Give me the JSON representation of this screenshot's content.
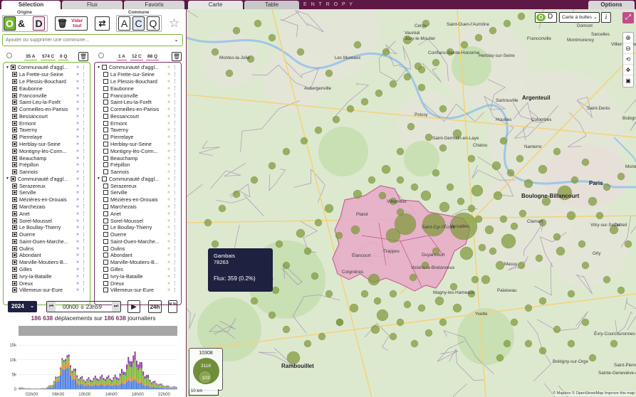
{
  "tabs": {
    "selection": "Sélection",
    "flux": "Flux",
    "favoris": "Favoris"
  },
  "map_tabs": {
    "carte": "Carte",
    "table": "Table",
    "options": "Options"
  },
  "brand": "E N T R O P Y",
  "origine": {
    "title": "Origine",
    "o_label": "O",
    "amp": "&",
    "d_label": "D",
    "vider": "Vider tout",
    "swap": "⇄"
  },
  "commune": {
    "title": "Commune",
    "a": "A",
    "c": "C",
    "q": "Q"
  },
  "search": {
    "placeholder": "Ajouter ou supprimer une commune..."
  },
  "left_list": {
    "counts": {
      "a": "35 A",
      "c": "574 C",
      "q": "0 Q"
    },
    "group1": "Communauté d'aggl...",
    "items1": [
      "La Frette-sur-Seine",
      "Le Plessis-Bouchard",
      "Eaubonne",
      "Franconville",
      "Saint-Leu-la-Forêt",
      "Cormeilles-en-Parisis",
      "Bessancourt",
      "Ermont",
      "Taverny",
      "Pierrelaye",
      "Herblay-sur-Seine",
      "Montigny-lès-Corm...",
      "Beauchamp",
      "Frépillon",
      "Sannois"
    ],
    "group2": "Communauté d'aggl...",
    "items2": [
      "Serazereux",
      "Serville",
      "Mézières-en-Drouais",
      "Marchezais",
      "Anet",
      "Sorel-Moussel",
      "Le Boullay-Thierry",
      "Ouerre",
      "Saint-Ouen-Marche...",
      "Oulins",
      "Abondant",
      "Marville-Moutiers-B...",
      "Gilles",
      "Ivry-la-Bataille",
      "Dreux",
      "Villemeux-sur-Eure"
    ]
  },
  "right_list": {
    "counts": {
      "a": "1 A",
      "c": "12 C",
      "q": "88 Q"
    },
    "group1": "Communauté d'aggl...",
    "items1": [
      "La Frette-sur-Seine",
      "Le Plessis-Bouchard",
      "Eaubonne",
      "Franconville",
      "Saint-Leu-la-Forêt",
      "Cormeilles-en-Parisis",
      "Bessancourt",
      "Ermont",
      "Taverny",
      "Pierrelaye",
      "Herblay-sur-Seine",
      "Montigny-lès-Corm...",
      "Beauchamp",
      "Frépillon",
      "Sannois"
    ],
    "group2": "Communauté d'aggl...",
    "items2": [
      "Serazereux",
      "Serville",
      "Mézières-en-Drouais",
      "Marchezais",
      "Anet",
      "Sorel-Moussel",
      "Le Boullay-Thierry",
      "Ouerre",
      "Saint-Ouen-Marche...",
      "Oulins",
      "Abondant",
      "Marville-Moutiers-B...",
      "Gilles",
      "Ivry-la-Bataille",
      "Dreux",
      "Villemeux-sur-Eure"
    ]
  },
  "time": {
    "year": "2024",
    "from": "00h00",
    "a": "à",
    "to": "23h59",
    "h24": "24h",
    "pct": "N %"
  },
  "summary": {
    "count1": "186 638",
    "mid": "déplacements sur",
    "count2": "186 638",
    "tail": "journaliers"
  },
  "chart_data": {
    "type": "bar",
    "stacked": true,
    "x_ticks": [
      "02h00",
      "06h00",
      "10h00",
      "14h00",
      "18h00",
      "22h00"
    ],
    "y_ticks": [
      "0",
      "5k",
      "10k",
      "15k"
    ],
    "ylim": [
      0,
      16000
    ],
    "categories": [
      "00h",
      "01h",
      "02h",
      "03h",
      "04h",
      "05h",
      "06h",
      "07h",
      "08h",
      "09h",
      "10h",
      "11h",
      "12h",
      "13h",
      "14h",
      "15h",
      "16h",
      "17h",
      "18h",
      "19h",
      "20h",
      "21h",
      "22h",
      "23h"
    ],
    "series": [
      {
        "color": "#4c7ee0",
        "values": [
          300,
          150,
          100,
          100,
          200,
          900,
          3500,
          8500,
          4000,
          1800,
          1200,
          1300,
          1500,
          1400,
          1300,
          1500,
          2200,
          3200,
          2500,
          1400,
          800,
          600,
          400,
          300
        ]
      },
      {
        "color": "#e08a2a",
        "values": [
          100,
          50,
          50,
          50,
          80,
          300,
          800,
          2000,
          1500,
          700,
          500,
          500,
          600,
          600,
          500,
          600,
          900,
          1300,
          1100,
          600,
          300,
          200,
          150,
          100
        ]
      },
      {
        "color": "#7ab833",
        "values": [
          150,
          80,
          60,
          60,
          100,
          400,
          900,
          1600,
          1500,
          1200,
          1100,
          1200,
          1400,
          1500,
          1400,
          1700,
          2800,
          4800,
          4500,
          2300,
          1200,
          800,
          500,
          300
        ]
      },
      {
        "color": "#8b3fa8",
        "values": [
          100,
          50,
          40,
          40,
          60,
          200,
          400,
          700,
          800,
          700,
          600,
          700,
          800,
          800,
          700,
          900,
          1400,
          2500,
          2400,
          1200,
          600,
          400,
          250,
          150
        ]
      }
    ]
  },
  "map": {
    "mode": "Carte à bulles ⌄",
    "info": "i",
    "tooltip": {
      "name": "Gambais",
      "code": "78263",
      "flux": "Flux: 359 (0.2%)"
    },
    "legend": {
      "top": "10308",
      "mid": "3118",
      "bot": "103"
    },
    "scale": "10 km",
    "attribution": "© Mapbox © OpenStreetMap Improve this map",
    "towns": [
      {
        "n": "Montes-la-Jolie",
        "x": 46,
        "y": 65
      },
      {
        "n": "Les Mureaux",
        "x": 208,
        "y": 65
      },
      {
        "n": "Aubergenville",
        "x": 165,
        "y": 108
      },
      {
        "n": "Conflans-Sainte-Honorine",
        "x": 339,
        "y": 58
      },
      {
        "n": "Jouy-le-Moutier",
        "x": 306,
        "y": 38
      },
      {
        "n": "Vauréal",
        "x": 306,
        "y": 30
      },
      {
        "n": "Cergy",
        "x": 320,
        "y": 20
      },
      {
        "n": "Saint-Ouen-l'Aumône",
        "x": 365,
        "y": 18
      },
      {
        "n": "Herblay-sur-Seine",
        "x": 410,
        "y": 62
      },
      {
        "n": "Franconville",
        "x": 478,
        "y": 38
      },
      {
        "n": "Montmorency",
        "x": 534,
        "y": 40
      },
      {
        "n": "Sarcelles",
        "x": 568,
        "y": 32
      },
      {
        "n": "Domont",
        "x": 548,
        "y": 20
      },
      {
        "n": "Villiers-le-Bel",
        "x": 596,
        "y": 46
      },
      {
        "n": "Argenteuil",
        "x": 471,
        "y": 120,
        "big": 1
      },
      {
        "n": "Sartrouville",
        "x": 434,
        "y": 125
      },
      {
        "n": "Saint-Denis",
        "x": 562,
        "y": 136
      },
      {
        "n": "Poissy",
        "x": 320,
        "y": 145
      },
      {
        "n": "Houilles",
        "x": 434,
        "y": 152
      },
      {
        "n": "Colombes",
        "x": 484,
        "y": 152
      },
      {
        "n": "Bobigny",
        "x": 612,
        "y": 150
      },
      {
        "n": "Saint-Germain-en-Laye",
        "x": 345,
        "y": 178
      },
      {
        "n": "Chatou",
        "x": 402,
        "y": 188
      },
      {
        "n": "Nanterre",
        "x": 474,
        "y": 190
      },
      {
        "n": "Montreuil",
        "x": 616,
        "y": 218
      },
      {
        "n": "Paris",
        "x": 565,
        "y": 240,
        "big": 1
      },
      {
        "n": "Boulogne-Billancourt",
        "x": 470,
        "y": 258,
        "big": 1
      },
      {
        "n": "Plaisir",
        "x": 238,
        "y": 285
      },
      {
        "n": "Villepreux",
        "x": 281,
        "y": 267
      },
      {
        "n": "Saint-Cyr-l'École",
        "x": 330,
        "y": 303
      },
      {
        "n": "Versailles",
        "x": 370,
        "y": 302
      },
      {
        "n": "Élancourt",
        "x": 232,
        "y": 343
      },
      {
        "n": "Trappes",
        "x": 276,
        "y": 337
      },
      {
        "n": "Guyancourt",
        "x": 330,
        "y": 342
      },
      {
        "n": "Voisins-le-Bretonneux",
        "x": 315,
        "y": 360
      },
      {
        "n": "Clamart",
        "x": 478,
        "y": 295
      },
      {
        "n": "Créteil",
        "x": 600,
        "y": 300
      },
      {
        "n": "Vitry-sur-Seine",
        "x": 567,
        "y": 300
      },
      {
        "n": "Massy",
        "x": 446,
        "y": 355
      },
      {
        "n": "Orly",
        "x": 570,
        "y": 340
      },
      {
        "n": "Coignières",
        "x": 218,
        "y": 366
      },
      {
        "n": "Magny-les-Hameaux",
        "x": 346,
        "y": 395
      },
      {
        "n": "Yvette",
        "x": 405,
        "y": 425
      },
      {
        "n": "Palaiseau",
        "x": 436,
        "y": 392
      },
      {
        "n": "Évry-Courcouronnes",
        "x": 572,
        "y": 453
      },
      {
        "n": "Rambouillet",
        "x": 133,
        "y": 497,
        "big": 1
      },
      {
        "n": "Brétigny-sur-Orge",
        "x": 514,
        "y": 492
      },
      {
        "n": "Saint-Pierre-du-Perray",
        "x": 600,
        "y": 497
      },
      {
        "n": "Sainte-Geneviève-des-Bois",
        "x": 578,
        "y": 508
      }
    ],
    "highlight": {
      "color": "#e8aac9",
      "stroke": "#c24d8a"
    }
  }
}
